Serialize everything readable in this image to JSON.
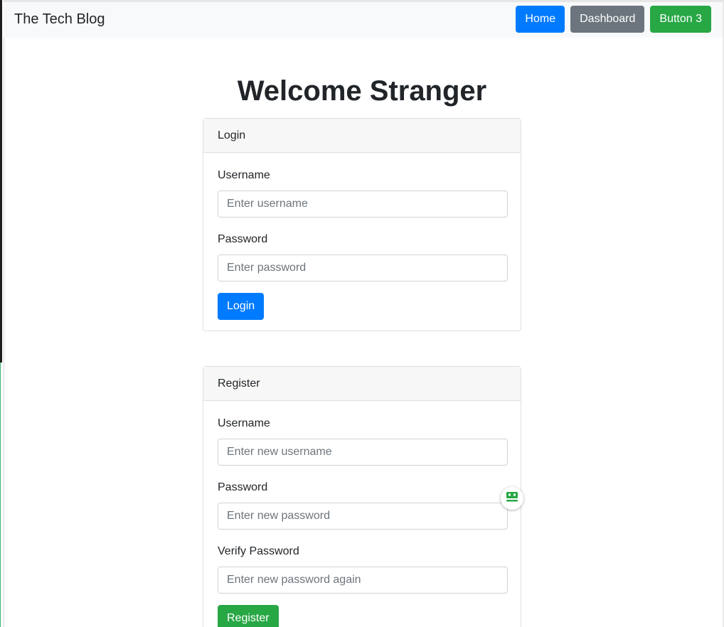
{
  "navbar": {
    "brand": "The Tech Blog",
    "buttons": [
      {
        "label": "Home",
        "style": "primary"
      },
      {
        "label": "Dashboard",
        "style": "secondary"
      },
      {
        "label": "Button 3",
        "style": "success"
      }
    ]
  },
  "page": {
    "title": "Welcome Stranger"
  },
  "login": {
    "header": "Login",
    "username_label": "Username",
    "username_placeholder": "Enter username",
    "username_value": "",
    "password_label": "Password",
    "password_placeholder": "Enter password",
    "password_value": "",
    "submit_label": "Login"
  },
  "register": {
    "header": "Register",
    "username_label": "Username",
    "username_placeholder": "Enter new username",
    "username_value": "",
    "password_label": "Password",
    "password_placeholder": "Enter new password",
    "password_value": "",
    "verify_label": "Verify Password",
    "verify_placeholder": "Enter new password again",
    "verify_value": "",
    "submit_label": "Register"
  },
  "widget": {
    "icon": "robot-face-icon",
    "color": "#28a745"
  },
  "colors": {
    "primary": "#007bff",
    "secondary": "#6c757d",
    "success": "#28a745",
    "navbar_bg": "#f8f9fa",
    "card_header_bg": "#f7f7f7"
  }
}
